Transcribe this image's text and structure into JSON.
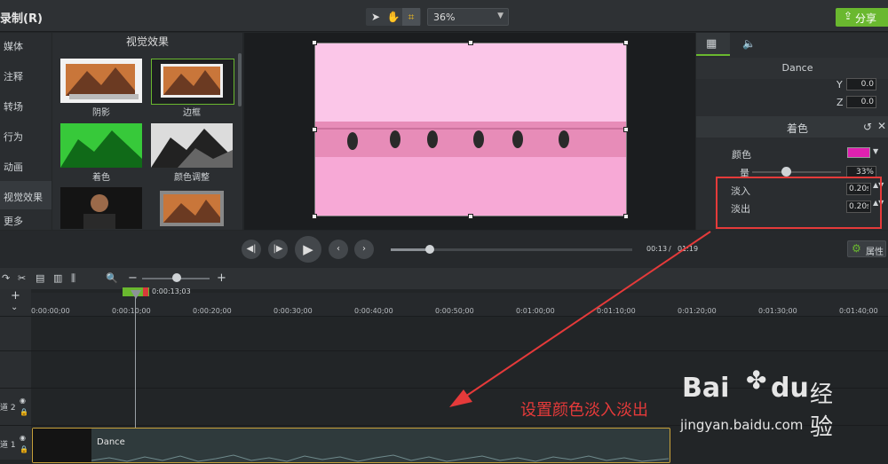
{
  "app": {
    "title": "录制(R)",
    "share_label": "分享",
    "zoom": "36%"
  },
  "left_nav": {
    "items": [
      "媒体",
      "注释",
      "转场",
      "行为",
      "动画",
      "视觉效果",
      "更多"
    ],
    "active": "视觉效果"
  },
  "effects": {
    "title": "视觉效果",
    "items": [
      {
        "label": "阴影"
      },
      {
        "label": "边框"
      },
      {
        "label": "着色"
      },
      {
        "label": "颜色调整"
      }
    ]
  },
  "properties": {
    "clip_name": "Dance",
    "y_label": "Y",
    "y_value": "0.0",
    "z_label": "Z",
    "z_value": "0.0",
    "section": "着色",
    "color_label": "颜色",
    "color_value": "#e020b0",
    "amount_label": "量",
    "amount_value": "33%",
    "amount_fraction": 0.33,
    "fade_in_label": "淡入",
    "fade_in_value": "0.20s",
    "fade_out_label": "淡出",
    "fade_out_value": "0.20s",
    "props_button": "属性"
  },
  "playback": {
    "current": "00:13",
    "sep": "/",
    "total": "01:19",
    "progress": 0.16
  },
  "timeline": {
    "playhead_time": "0:00:13;03",
    "ticks": [
      "0:00:00;00",
      "0:00:10;00",
      "0:00:20;00",
      "0:00:30;00",
      "0:00:40;00",
      "0:00:50;00",
      "0:01:00;00",
      "0:01:10;00",
      "0:01:20;00",
      "0:01:30;00",
      "0:01:40;00"
    ],
    "track2": "道 2",
    "track1": "道 1",
    "clip_label": "Dance"
  },
  "annotation": "设置颜色淡入淡出",
  "watermark": {
    "brand_a": "Bai",
    "brand_b": "du",
    "suffix": "经验",
    "url": "jingyan.baidu.com"
  },
  "colors": {
    "accent_green": "#6ab82f",
    "highlight_red": "#e53a3a",
    "tint": "#e020b0"
  }
}
